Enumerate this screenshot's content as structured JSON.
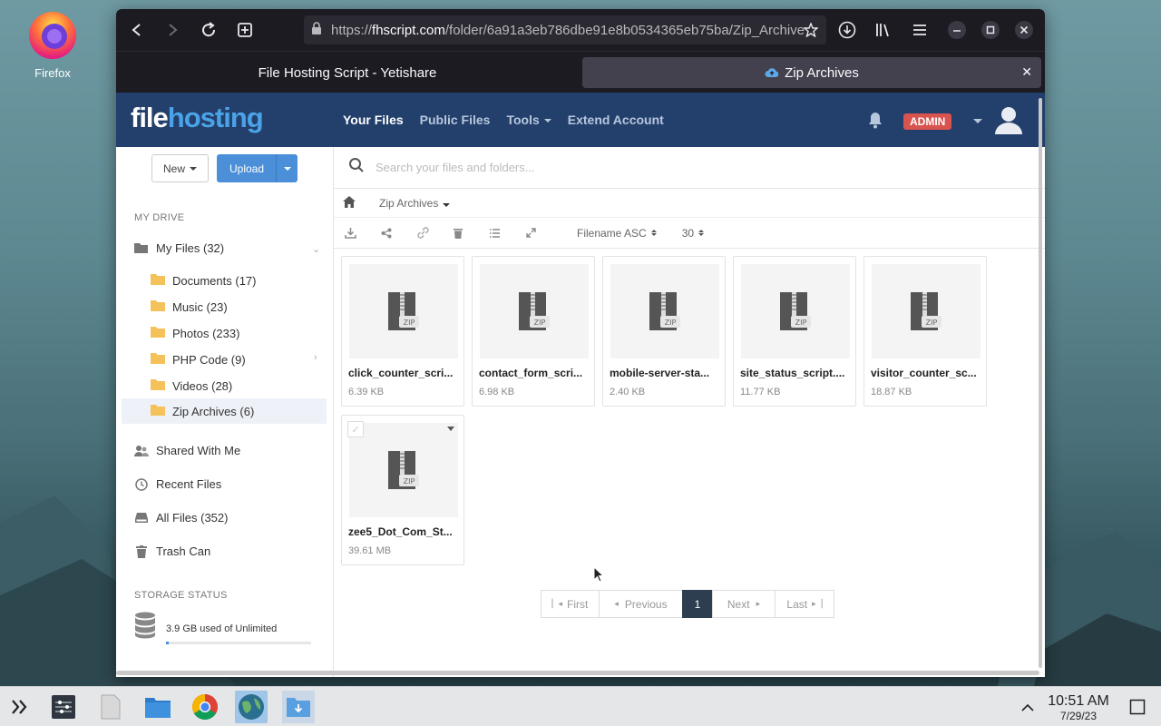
{
  "desktop": {
    "firefox_label": "Firefox"
  },
  "browser": {
    "url_host": "fhscript.com",
    "url_path": "/folder/6a91a3eb786dbe91e8b0534365eb75ba/Zip_Archive",
    "tabs": [
      {
        "label": "File Hosting Script - Yetishare"
      },
      {
        "label": "Zip Archives"
      }
    ],
    "close_glyph": "✕"
  },
  "site": {
    "logo_a": "file",
    "logo_b": "hosting",
    "nav": [
      {
        "label": "Your Files"
      },
      {
        "label": "Public Files"
      },
      {
        "label": "Tools"
      },
      {
        "label": "Extend Account"
      }
    ],
    "admin_badge": "ADMIN"
  },
  "sidebar": {
    "new_label": "New",
    "upload_label": "Upload",
    "my_drive_title": "MY DRIVE",
    "my_files": "My Files (32)",
    "folders": [
      {
        "label": "Documents (17)"
      },
      {
        "label": "Music (23)"
      },
      {
        "label": "Photos (233)"
      },
      {
        "label": "PHP Code (9)"
      },
      {
        "label": "Videos (28)"
      },
      {
        "label": "Zip Archives (6)"
      }
    ],
    "items": [
      {
        "label": "Shared With Me"
      },
      {
        "label": "Recent Files"
      },
      {
        "label": "All Files (352)"
      },
      {
        "label": "Trash Can"
      }
    ],
    "storage_title": "STORAGE STATUS",
    "storage_text": "3.9 GB used of Unlimited"
  },
  "main": {
    "search_placeholder": "Search your files and folders...",
    "breadcrumb_folder": "Zip Archives",
    "sort_label": "Filename ASC",
    "per_page": "30",
    "thumb_label": "ZIP",
    "files": [
      {
        "name": "click_counter_scri...",
        "size": "6.39 KB"
      },
      {
        "name": "contact_form_scri...",
        "size": "6.98 KB"
      },
      {
        "name": "mobile-server-sta...",
        "size": "2.40 KB"
      },
      {
        "name": "site_status_script....",
        "size": "11.77 KB"
      },
      {
        "name": "visitor_counter_sc...",
        "size": "18.87 KB"
      },
      {
        "name": "zee5_Dot_Com_St...",
        "size": "39.61 MB"
      }
    ],
    "pager": {
      "first": "First",
      "previous": "Previous",
      "current": "1",
      "next": "Next",
      "last": "Last"
    }
  },
  "taskbar": {
    "time": "10:51 AM",
    "date": "7/29/23"
  }
}
